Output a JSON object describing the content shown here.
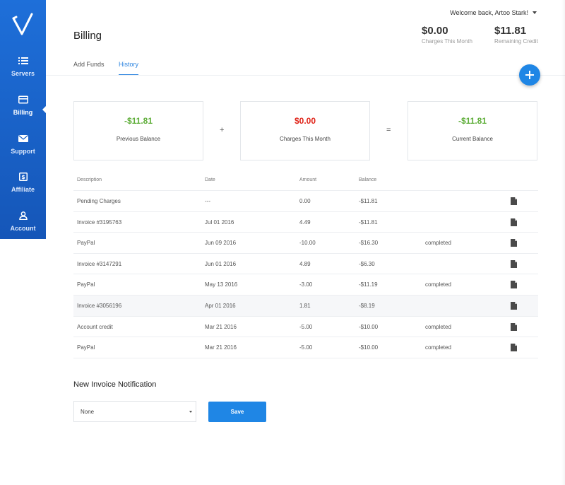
{
  "sidebar": {
    "logo_icon": "v-logo-icon",
    "items": [
      {
        "label": "Servers",
        "icon": "list-icon"
      },
      {
        "label": "Billing",
        "icon": "card-icon",
        "active": true
      },
      {
        "label": "Support",
        "icon": "envelope-icon"
      },
      {
        "label": "Affiliate",
        "icon": "dollar-icon"
      },
      {
        "label": "Account",
        "icon": "user-icon"
      }
    ]
  },
  "header": {
    "welcome": "Welcome back, Artoo Stark!",
    "title": "Billing",
    "stats": [
      {
        "value": "$0.00",
        "label": "Charges This Month"
      },
      {
        "value": "$11.81",
        "label": "Remaining Credit"
      }
    ]
  },
  "tabs": [
    {
      "label": "Add Funds"
    },
    {
      "label": "History",
      "active": true
    }
  ],
  "summary": {
    "cards": [
      {
        "value": "-$11.81",
        "label": "Previous Balance",
        "color": "#5fae3a"
      },
      {
        "value": "$0.00",
        "label": "Charges This Month",
        "color": "#e0261b"
      },
      {
        "value": "-$11.81",
        "label": "Current Balance",
        "color": "#5fae3a"
      }
    ],
    "operators": [
      "+",
      "="
    ]
  },
  "table": {
    "headers": [
      "Description",
      "Date",
      "Amount",
      "Balance"
    ],
    "rows": [
      {
        "description": "Pending Charges",
        "date": "---",
        "amount": "0.00",
        "balance": "-$11.81",
        "status": ""
      },
      {
        "description": "Invoice #3195763",
        "date": "Jul 01 2016",
        "amount": "4.49",
        "balance": "-$11.81",
        "status": ""
      },
      {
        "description": "PayPal",
        "date": "Jun 09 2016",
        "amount": "-10.00",
        "balance": "-$16.30",
        "status": "completed"
      },
      {
        "description": "Invoice #3147291",
        "date": "Jun 01 2016",
        "amount": "4.89",
        "balance": "-$6.30",
        "status": ""
      },
      {
        "description": "PayPal",
        "date": "May 13 2016",
        "amount": "-3.00",
        "balance": "-$11.19",
        "status": "completed"
      },
      {
        "description": "Invoice #3056196",
        "date": "Apr 01 2016",
        "amount": "1.81",
        "balance": "-$8.19",
        "status": ""
      },
      {
        "description": "Account credit",
        "date": "Mar 21 2016",
        "amount": "-5.00",
        "balance": "-$10.00",
        "status": "completed"
      },
      {
        "description": "PayPal",
        "date": "Mar 21 2016",
        "amount": "-5.00",
        "balance": "-$10.00",
        "status": "completed"
      }
    ]
  },
  "notification": {
    "title": "New Invoice Notification",
    "selected": "None",
    "save_label": "Save"
  },
  "colors": {
    "sidebar": "#1e6fd9",
    "accent": "#1f86e5",
    "positive": "#5fae3a",
    "negative": "#e0261b"
  }
}
